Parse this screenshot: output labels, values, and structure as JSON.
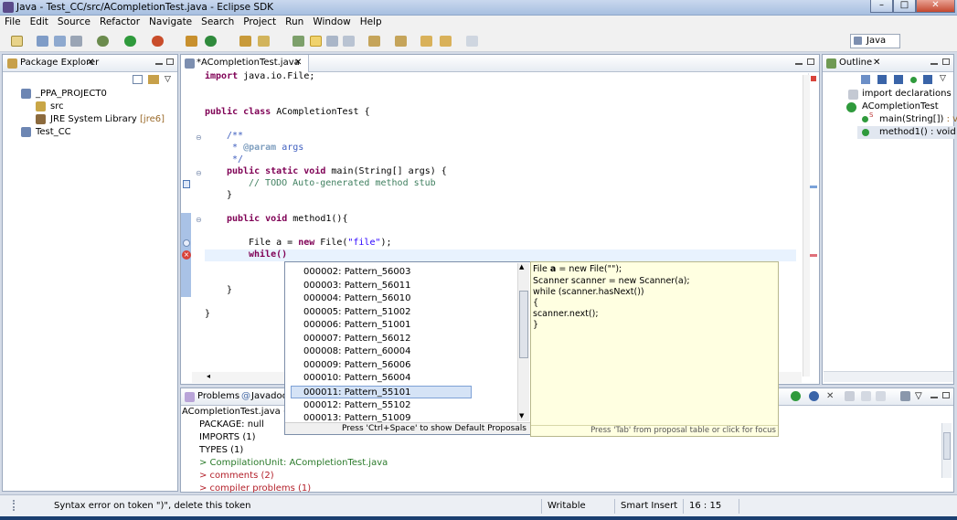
{
  "window": {
    "title": "Java - Test_CC/src/ACompletionTest.java - Eclipse SDK",
    "controls": {
      "minimize": "–",
      "maximize": "□",
      "close": "✕"
    }
  },
  "menu": [
    "File",
    "Edit",
    "Source",
    "Refactor",
    "Navigate",
    "Search",
    "Project",
    "Run",
    "Window",
    "Help"
  ],
  "perspective": {
    "label": "Java"
  },
  "package_explorer": {
    "tab": "Package Explorer",
    "items": [
      {
        "label": "_PPA_PROJECT0"
      },
      {
        "label": "src"
      },
      {
        "label": "JRE System Library",
        "suffix": "[jre6]"
      },
      {
        "label": "Test_CC"
      }
    ]
  },
  "editor": {
    "tab": "*ACompletionTest.java",
    "lines": {
      "l1_kw": "import",
      "l1_rest": " java.io.File;",
      "l2_kw": "public class",
      "l2_rest": " ACompletionTest {",
      "l3": "/**",
      "l4_pre": " * ",
      "l4_tag": "@param",
      "l4_rest": " args",
      "l5": " */",
      "l6_kw": "public static void",
      "l6_rest": " main(String[] args) {",
      "l7": "// TODO Auto-generated method stub",
      "l8": "}",
      "l9_kw": "public void",
      "l9_rest": " method1(){",
      "l10_pre": "File a = ",
      "l10_kw": "new",
      "l10_mid": " File(",
      "l10_str": "\"file\"",
      "l10_end": ");",
      "l11": "while()",
      "l12": "}",
      "l13": "}"
    }
  },
  "outline": {
    "tab": "Outline",
    "items": [
      {
        "label": "import declarations"
      },
      {
        "label": "ACompletionTest"
      },
      {
        "label": "main(String[])",
        "suffix": " : void"
      },
      {
        "label": "method1() : void"
      }
    ],
    "s_marker": "S"
  },
  "content_assist": {
    "items": [
      "000002: Pattern_56003",
      "000003: Pattern_56011",
      "000004: Pattern_56010",
      "000005: Pattern_51002",
      "000006: Pattern_51001",
      "000007: Pattern_56012",
      "000008: Pattern_60004",
      "000009: Pattern_56006",
      "000010: Pattern_56004",
      "000011: Pattern_55101",
      "000012: Pattern_55102",
      "000013: Pattern_51009"
    ],
    "selected_index": 9,
    "footer": "Press 'Ctrl+Space' to show Default Proposals"
  },
  "proposal_doc": {
    "lines": [
      "File a = new File(\"\");",
      "Scanner scanner = new Scanner(a);",
      "while (scanner.hasNext())",
      "{",
      "scanner.next();",
      "}"
    ],
    "bold_word": "a",
    "footer": "Press 'Tab' from proposal table or click for focus"
  },
  "bottom_panel": {
    "tabs": [
      "Problems",
      "Javadoc"
    ],
    "header": "ACompletionTest.java (AST",
    "items": [
      {
        "label": "PACKAGE: null"
      },
      {
        "label": "IMPORTS (1)"
      },
      {
        "label": "TYPES (1)"
      },
      {
        "label": "> CompilationUnit: ACompletionTest.java"
      },
      {
        "label": "> comments (2)"
      },
      {
        "label": "> compiler problems (1)"
      }
    ]
  },
  "status": {
    "message": "Syntax error on token \")\", delete this token",
    "writable": "Writable",
    "insert_mode": "Smart Insert",
    "position": "16 : 15"
  }
}
